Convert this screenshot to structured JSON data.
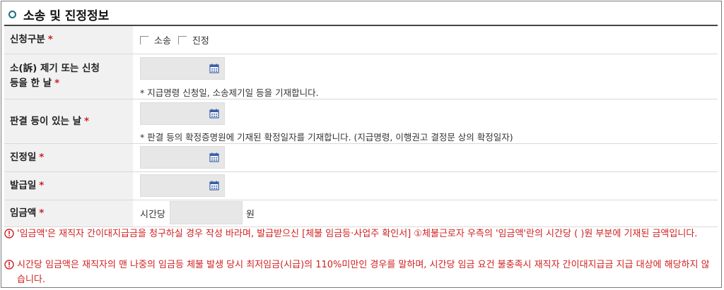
{
  "section": {
    "title": "소송 및 진정정보"
  },
  "rows": {
    "type": {
      "label": "신청구분",
      "required": "*",
      "options": [
        "소송",
        "진정"
      ]
    },
    "filing": {
      "label_line1": "소(訴) 제기 또는 신청",
      "label_line2": "등을 한 날",
      "required": "*",
      "hint": "* 지급명령 신청일, 소송제기일 등을 기재합니다."
    },
    "judgment": {
      "label": "판결 등이 있는 날",
      "required": "*",
      "hint": "* 판결 등의 확정증명원에 기재된 확정일자를 기재합니다. (지급명령, 이행권고 결정문 상의 확정일자)"
    },
    "petition": {
      "label": "진정일",
      "required": "*"
    },
    "issue": {
      "label": "발급일",
      "required": "*"
    },
    "wage": {
      "label": "임금액",
      "required": "*",
      "prefix": "시간당",
      "suffix": "원"
    }
  },
  "notices": [
    "'임금액'은 재직자 간이대지급금을 청구하실 경우 작성 바라며, 발급받으신 [체불 임금등·사업주 확인서] ①체불근로자 우측의 '임금액'란의 시간당 (      )원 부분에 기재된 금액입니다.",
    "시간당 임금액은 재직자의 맨 나중의 임금등 체불 발생 당시 최저임금(시급)의 110%미만인 경우를 말하며, 시간당 임금 요건 불충족시 재직자 간이대지급금 지급 대상에 해당하지 않습니다."
  ],
  "colors": {
    "accent": "#1a6f7f",
    "required": "#d02020",
    "notice": "#d02020",
    "calendar": "#3a5fa8"
  },
  "icons": {
    "title": "circle-bullet-icon",
    "date": "calendar-icon",
    "notice": "warning-circle-icon"
  }
}
